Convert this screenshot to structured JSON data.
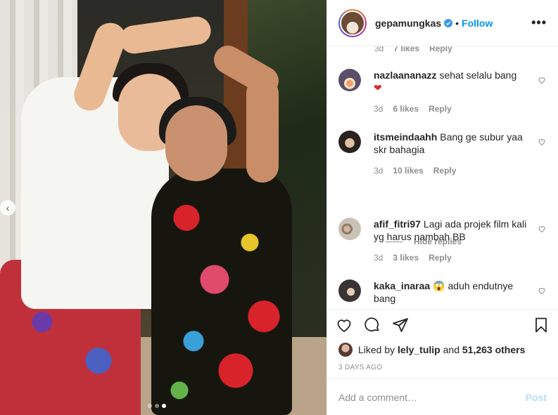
{
  "post": {
    "username": "gepamungkas",
    "follow_label": "Follow",
    "bullet": "•",
    "more_label": "•••"
  },
  "partial_comment": {
    "time": "3d",
    "likes": "7 likes",
    "reply": "Reply"
  },
  "comments": [
    {
      "user": "nazlaananazz",
      "text": "sehat selalu bang",
      "emoji": "❤",
      "time": "3d",
      "likes": "6 likes",
      "reply": "Reply"
    },
    {
      "user": "itsmeindaahh",
      "text": "Bang ge subur yaa skr bahagia",
      "time": "3d",
      "likes": "10 likes",
      "reply": "Reply"
    },
    {
      "user": "afif_fitri97",
      "text": "Lagi ada projek film kali yg harus nambah BB",
      "time": "3d",
      "likes": "3 likes",
      "reply": "Reply"
    },
    {
      "user": "kaka_inaraa",
      "emoji": "😱",
      "text": "aduh endutnye bang"
    }
  ],
  "hide_replies": "Hide replies",
  "liked_by": {
    "prefix": "Liked by",
    "user": "lely_tulip",
    "and": "and",
    "others": "51,263 others"
  },
  "timestamp": "3 DAYS AGO",
  "add_comment": {
    "placeholder": "Add a comment…",
    "post_label": "Post"
  },
  "carousel": {
    "prev_label": "‹",
    "dots": 3,
    "active_dot": 2
  },
  "colors": {
    "accent": "#0095f6",
    "post_disabled": "#b2dffc",
    "heart": "#ed4956"
  }
}
